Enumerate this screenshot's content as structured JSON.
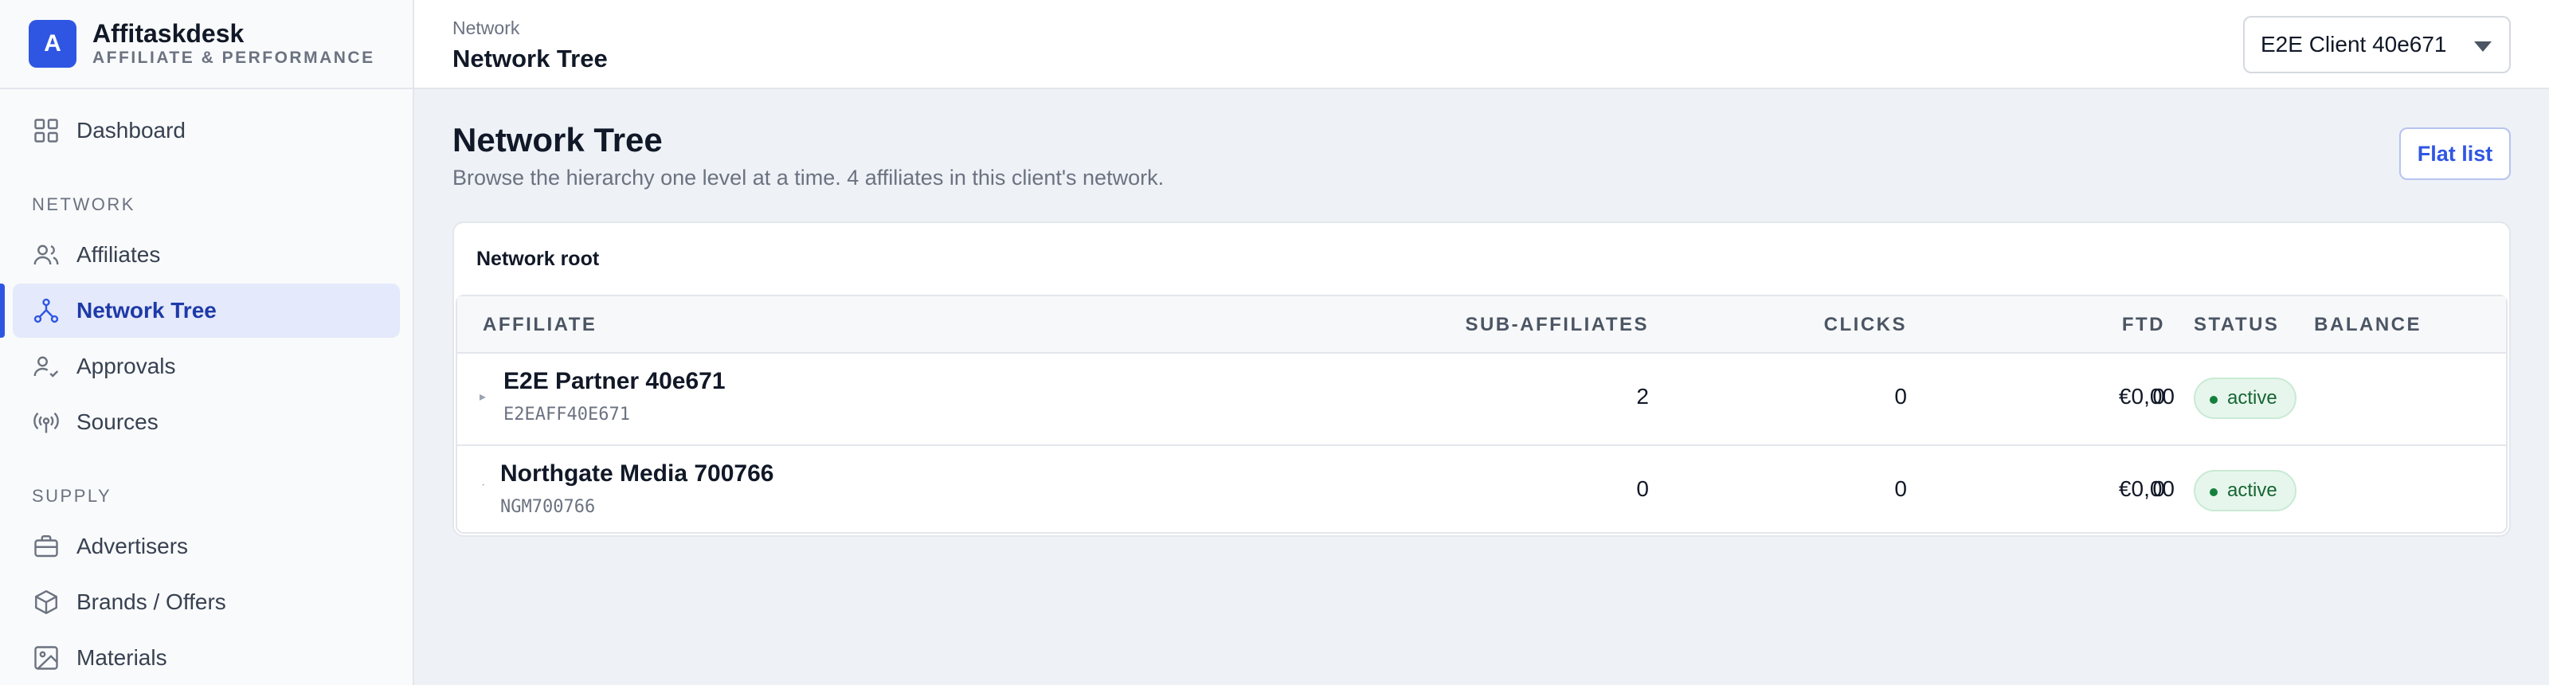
{
  "brand": {
    "logo_letter": "A",
    "name": "Affitaskdesk",
    "subtitle": "AFFILIATE & PERFORMANCE",
    "accent": "#2f56e3"
  },
  "sidebar": {
    "dashboard": {
      "label": "Dashboard",
      "icon": "grid-icon"
    },
    "network_section": "NETWORK",
    "affiliates": {
      "label": "Affiliates",
      "icon": "users-icon"
    },
    "network_tree": {
      "label": "Network Tree",
      "icon": "network-tree-icon"
    },
    "approvals": {
      "label": "Approvals",
      "icon": "user-check-icon"
    },
    "sources": {
      "label": "Sources",
      "icon": "broadcast-icon"
    },
    "supply_section": "SUPPLY",
    "advertisers": {
      "label": "Advertisers",
      "icon": "briefcase-icon"
    },
    "brands": {
      "label": "Brands / Offers",
      "icon": "box-icon"
    },
    "materials": {
      "label": "Materials",
      "icon": "image-icon"
    }
  },
  "header": {
    "breadcrumb": "Network",
    "title": "Network Tree",
    "client_select": "E2E Client 40e671"
  },
  "main": {
    "title": "Network Tree",
    "subtitle": "Browse the hierarchy one level at a time. 4 affiliates in this client's network.",
    "flat_list_label": "Flat list",
    "card_title": "Network root",
    "columns": {
      "affiliate": "AFFILIATE",
      "sub_affiliates": "SUB-AFFILIATES",
      "clicks": "CLICKS",
      "ftd": "FTD",
      "balance": "BALANCE",
      "status": "STATUS"
    },
    "rows": [
      {
        "toggle": "▸",
        "name": "E2E Partner 40e671",
        "code": "E2EAFF40E671",
        "sub_affiliates": "2",
        "clicks": "0",
        "ftd": "0",
        "balance": "€0,00",
        "status": "active"
      },
      {
        "toggle": "·",
        "name": "Northgate Media 700766",
        "code": "NGM700766",
        "sub_affiliates": "0",
        "clicks": "0",
        "ftd": "0",
        "balance": "€0,00",
        "status": "active"
      }
    ]
  }
}
